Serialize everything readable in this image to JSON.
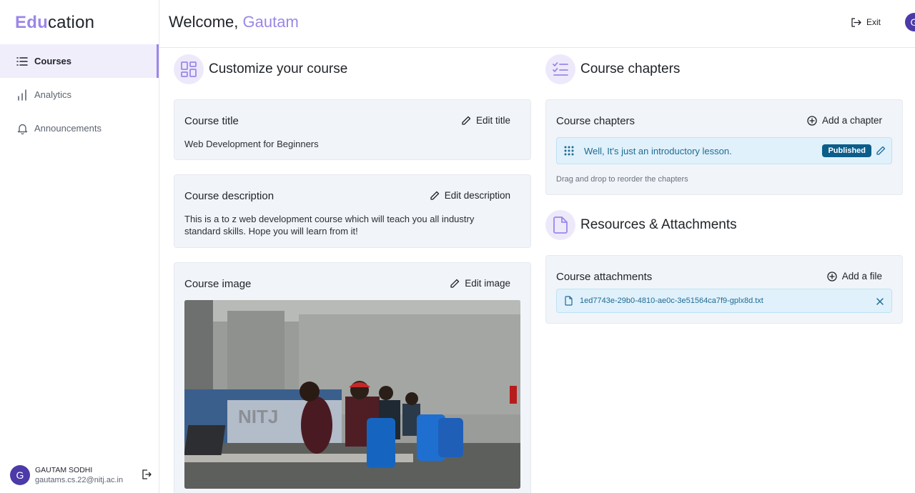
{
  "brand": {
    "accent": "Edu",
    "rest": "cation"
  },
  "sidebar": {
    "items": [
      {
        "label": "Courses",
        "icon": "list-icon",
        "active": true
      },
      {
        "label": "Analytics",
        "icon": "bar-chart-icon",
        "active": false
      },
      {
        "label": "Announcements",
        "icon": "bell-icon",
        "active": false
      }
    ],
    "user": {
      "initial": "G",
      "name": "GAUTAM SODHI",
      "email": "gautams.cs.22@nitj.ac.in"
    }
  },
  "header": {
    "welcome": "Welcome,",
    "name": "Gautam",
    "exit_label": "Exit",
    "avatar_initial": "G"
  },
  "customize": {
    "title": "Customize your course",
    "course_title": {
      "label": "Course title",
      "action": "Edit title",
      "value": "Web Development for Beginners"
    },
    "course_description": {
      "label": "Course description",
      "action": "Edit description",
      "value": "This is a to z web development course which will teach you all industry standard skills. Hope you will learn from it!"
    },
    "course_image": {
      "label": "Course image",
      "action": "Edit image",
      "watermark": "NITJ"
    }
  },
  "chapters": {
    "section_title": "Course chapters",
    "card_title": "Course chapters",
    "action": "Add a chapter",
    "items": [
      {
        "title": "Well, It's just an introductory lesson.",
        "status": "Published"
      }
    ],
    "hint": "Drag and drop to reorder the chapters"
  },
  "resources": {
    "section_title": "Resources & Attachments",
    "card_title": "Course attachments",
    "action": "Add a file",
    "files": [
      {
        "name": "1ed7743e-29b0-4810-ae0c-3e51564ca7f9-gplx8d.txt"
      }
    ]
  },
  "colors": {
    "accent": "#9b87e8",
    "published": "#0b5d8a",
    "card_bg": "#f1f4f8",
    "row_bg": "#e0f1fb"
  }
}
